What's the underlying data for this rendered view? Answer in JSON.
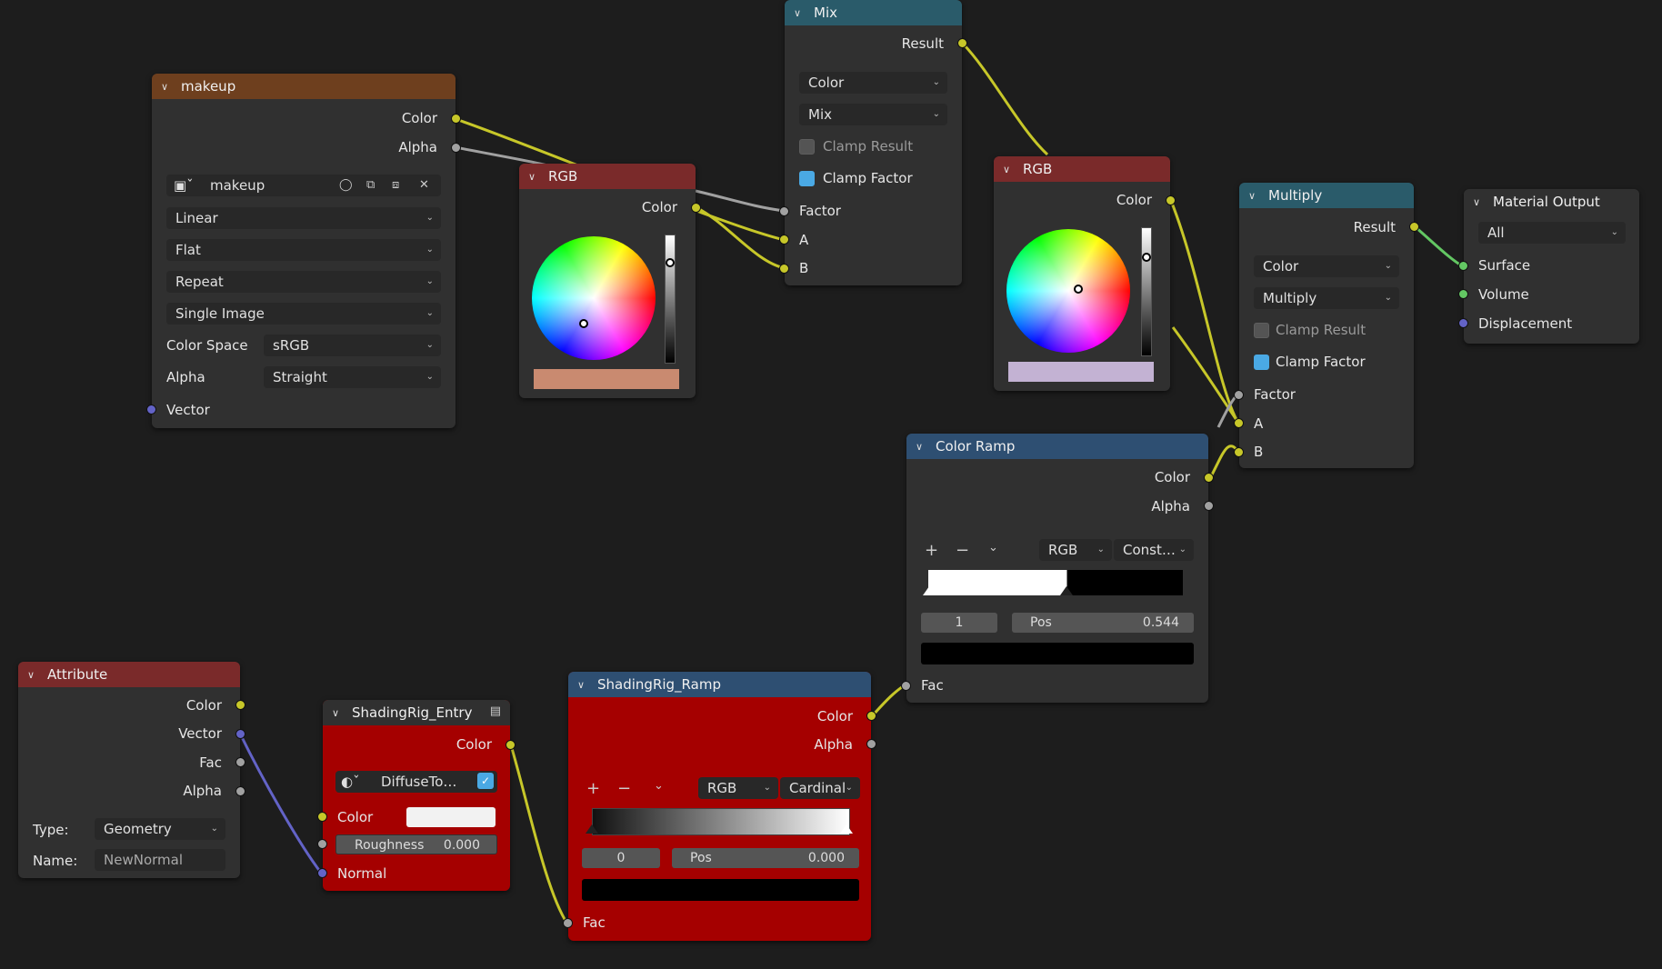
{
  "nodes": {
    "makeup": {
      "title": "makeup",
      "out_color": "Color",
      "out_alpha": "Alpha",
      "image_name": "makeup",
      "interpolation": "Linear",
      "projection": "Flat",
      "extension": "Repeat",
      "source": "Single Image",
      "color_space_label": "Color Space",
      "color_space": "sRGB",
      "alpha_label": "Alpha",
      "alpha": "Straight",
      "in_vector": "Vector"
    },
    "rgb1": {
      "title": "RGB",
      "out_color": "Color",
      "swatch": "#c98a70"
    },
    "mix": {
      "title": "Mix",
      "out_result": "Result",
      "data_type": "Color",
      "blend": "Mix",
      "clamp_result": "Clamp Result",
      "clamp_factor": "Clamp Factor",
      "in_factor": "Factor",
      "in_a": "A",
      "in_b": "B"
    },
    "rgb2": {
      "title": "RGB",
      "out_color": "Color",
      "swatch": "#c3b2d3"
    },
    "multiply": {
      "title": "Multiply",
      "out_result": "Result",
      "data_type": "Color",
      "blend": "Multiply",
      "clamp_result": "Clamp Result",
      "clamp_factor": "Clamp Factor",
      "in_factor": "Factor",
      "in_a": "A",
      "in_b": "B"
    },
    "material_output": {
      "title": "Material Output",
      "target": "All",
      "in_surface": "Surface",
      "in_volume": "Volume",
      "in_displacement": "Displacement"
    },
    "color_ramp": {
      "title": "Color Ramp",
      "out_color": "Color",
      "out_alpha": "Alpha",
      "mode": "RGB",
      "interp": "Const…",
      "index": "1",
      "pos_label": "Pos",
      "pos_value": "0.544",
      "in_fac": "Fac"
    },
    "attribute": {
      "title": "Attribute",
      "out_color": "Color",
      "out_vector": "Vector",
      "out_fac": "Fac",
      "out_alpha": "Alpha",
      "type_label": "Type:",
      "type_value": "Geometry",
      "name_label": "Name:",
      "name_value": "NewNormal"
    },
    "entry": {
      "title": "ShadingRig_Entry",
      "out_color": "Color",
      "group_name": "DiffuseTo…",
      "in_color": "Color",
      "roughness_label": "Roughness",
      "roughness_value": "0.000",
      "in_normal": "Normal"
    },
    "ramp2": {
      "title": "ShadingRig_Ramp",
      "out_color": "Color",
      "out_alpha": "Alpha",
      "mode": "RGB",
      "interp": "Cardinal",
      "index": "0",
      "pos_label": "Pos",
      "pos_value": "0.000",
      "in_fac": "Fac"
    }
  },
  "colors": {
    "socket_color": "#c7c729",
    "socket_float": "#a1a1a1",
    "socket_vector": "#6363c7",
    "socket_shader": "#63c763",
    "group_body": "#a50000"
  },
  "icons": [
    "chevron-down-icon",
    "image-icon",
    "shield-icon",
    "duplicate-icon",
    "copy-icon",
    "close-icon",
    "plus-icon",
    "minus-icon",
    "node-tree-icon"
  ]
}
